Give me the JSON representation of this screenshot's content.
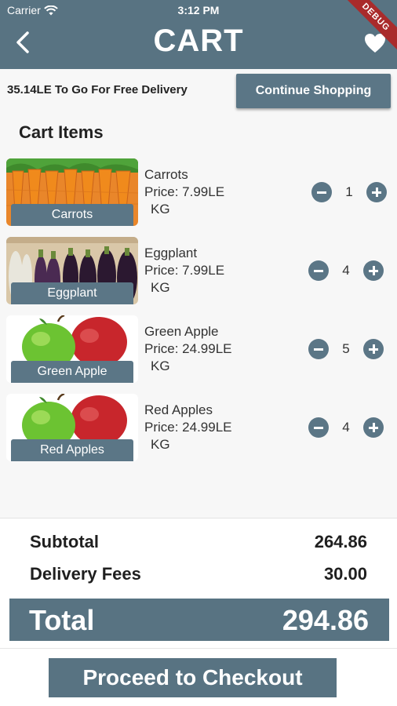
{
  "status_bar": {
    "carrier": "Carrier",
    "time": "3:12 PM"
  },
  "header": {
    "title": "CART",
    "back_icon": "chevron-left-icon",
    "favorite_icon": "heart-icon",
    "debug_banner": "DEBUG"
  },
  "promo": {
    "text": "35.14LE To Go For Free Delivery",
    "continue_label": "Continue Shopping"
  },
  "cart": {
    "section_title": "Cart Items",
    "items": [
      {
        "name": "Carrots",
        "label": "Carrots",
        "price": "Price: 7.99LE",
        "unit": "KG",
        "quantity": "1"
      },
      {
        "name": "Eggplant",
        "label": "Eggplant",
        "price": "Price: 7.99LE",
        "unit": "KG",
        "quantity": "4"
      },
      {
        "name": "Green Apple",
        "label": "Green Apple",
        "price": "Price: 24.99LE",
        "unit": "KG",
        "quantity": "5"
      },
      {
        "name": "Red Apples",
        "label": "Red Apples",
        "price": "Price: 24.99LE",
        "unit": "KG",
        "quantity": "4"
      }
    ]
  },
  "summary": {
    "subtotal_label": "Subtotal",
    "subtotal_value": "264.86",
    "delivery_label": "Delivery Fees",
    "delivery_value": "30.00",
    "total_label": "Total",
    "total_value": "294.86"
  },
  "checkout": {
    "label": "Proceed to Checkout"
  },
  "colors": {
    "primary": "#587382",
    "button": "#5b7686",
    "debug": "#a92b2b"
  }
}
